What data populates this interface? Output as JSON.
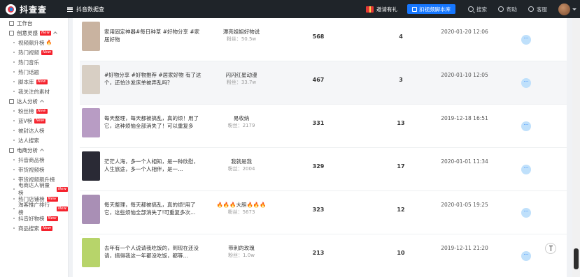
{
  "header": {
    "logo_text": "抖查查",
    "menu_title": "抖音数据查",
    "invite_label": "邀请有礼",
    "script_button_label": "扣视频脚本库",
    "search_label": "搜索",
    "help_label": "帮助",
    "service_label": "客服"
  },
  "sidebar": {
    "workbench": "工作台",
    "creative": {
      "label": "创意灵感",
      "badge": "New",
      "items": [
        {
          "label": "视频飙升榜",
          "badge": "",
          "fire": "🔥"
        },
        {
          "label": "热门视频",
          "badge": "New"
        },
        {
          "label": "热门音乐",
          "badge": ""
        },
        {
          "label": "热门话题",
          "badge": ""
        },
        {
          "label": "脚本库",
          "badge": "New"
        },
        {
          "label": "我关注的素材",
          "badge": ""
        }
      ]
    },
    "talent": {
      "label": "达人分析",
      "items": [
        {
          "label": "粉丝榜",
          "badge": "New"
        },
        {
          "label": "蓝V榜",
          "badge": "New"
        },
        {
          "label": "被封达人榜",
          "badge": ""
        },
        {
          "label": "达人搜索",
          "badge": ""
        }
      ]
    },
    "ecommerce": {
      "label": "电商分析",
      "items": [
        {
          "label": "抖音商品榜",
          "badge": ""
        },
        {
          "label": "带货视频榜",
          "badge": ""
        },
        {
          "label": "带货视频飙升榜",
          "badge": ""
        },
        {
          "label": "电商达人销量榜",
          "badge": "New"
        },
        {
          "label": "热门店铺榜",
          "badge": "New"
        },
        {
          "label": "淘客推广排行榜",
          "badge": "New"
        },
        {
          "label": "抖音好物榜",
          "badge": "New"
        },
        {
          "label": "商品搜索",
          "badge": "New"
        }
      ]
    }
  },
  "rows": [
    {
      "title": "家用固定神器#每日种草 #好物分享 #家居好物",
      "author": "漂亮姐姐好物说",
      "fans": "粉丝：50.5w",
      "likes": "568",
      "comments": "4",
      "time": "2020-01-20 12:06",
      "more": "···",
      "thumb_color": "#c9b3a0"
    },
    {
      "title": "#好物分享 #好物推荐 #居家好物 有了这个，还怕沙发床单被弄乱吗？",
      "author": "闪闪红星动漫",
      "fans": "粉丝：33.7w",
      "likes": "467",
      "comments": "3",
      "time": "2020-01-10 12:05",
      "more": "···",
      "thumb_color": "#d8cfc4"
    },
    {
      "title": "每天整理，每天都被搞乱，真的烦！用了它，这种烦恼全部消失了！可以重复多次…",
      "author": "易收纳",
      "fans": "粉丝：2179",
      "likes": "331",
      "comments": "13",
      "time": "2019-12-18 16:51",
      "more": "···",
      "thumb_color": "#b89cc4"
    },
    {
      "title": "茫茫人海，多一个人相知，是一种欣慰，人生旅途，多一个人相伴，是一…",
      "author": "我就是我",
      "fans": "粉丝：2004",
      "likes": "329",
      "comments": "17",
      "time": "2020-01-01 11:34",
      "more": "···",
      "thumb_color": "#2a2a35"
    },
    {
      "title": "每天整理，每天都被搞乱，真的烦!用了它，这些烦恼全部消失了!可重复多次…",
      "author": "🔥🔥🔥大胆🔥🔥🔥",
      "fans": "粉丝：5673",
      "likes": "323",
      "comments": "12",
      "time": "2020-01-05 19:25",
      "more": "···",
      "thumb_color": "#a98fb5"
    },
    {
      "title": "去年有一个人说请我吃饭的，到现在还没请，搞得我这一年都没吃饭，都等…",
      "author": "带刺的玫瑰",
      "fans": "粉丝：1.0w",
      "likes": "213",
      "comments": "10",
      "time": "2019-12-11 21:20",
      "more": "···",
      "thumb_color": "#b7d46a"
    }
  ]
}
